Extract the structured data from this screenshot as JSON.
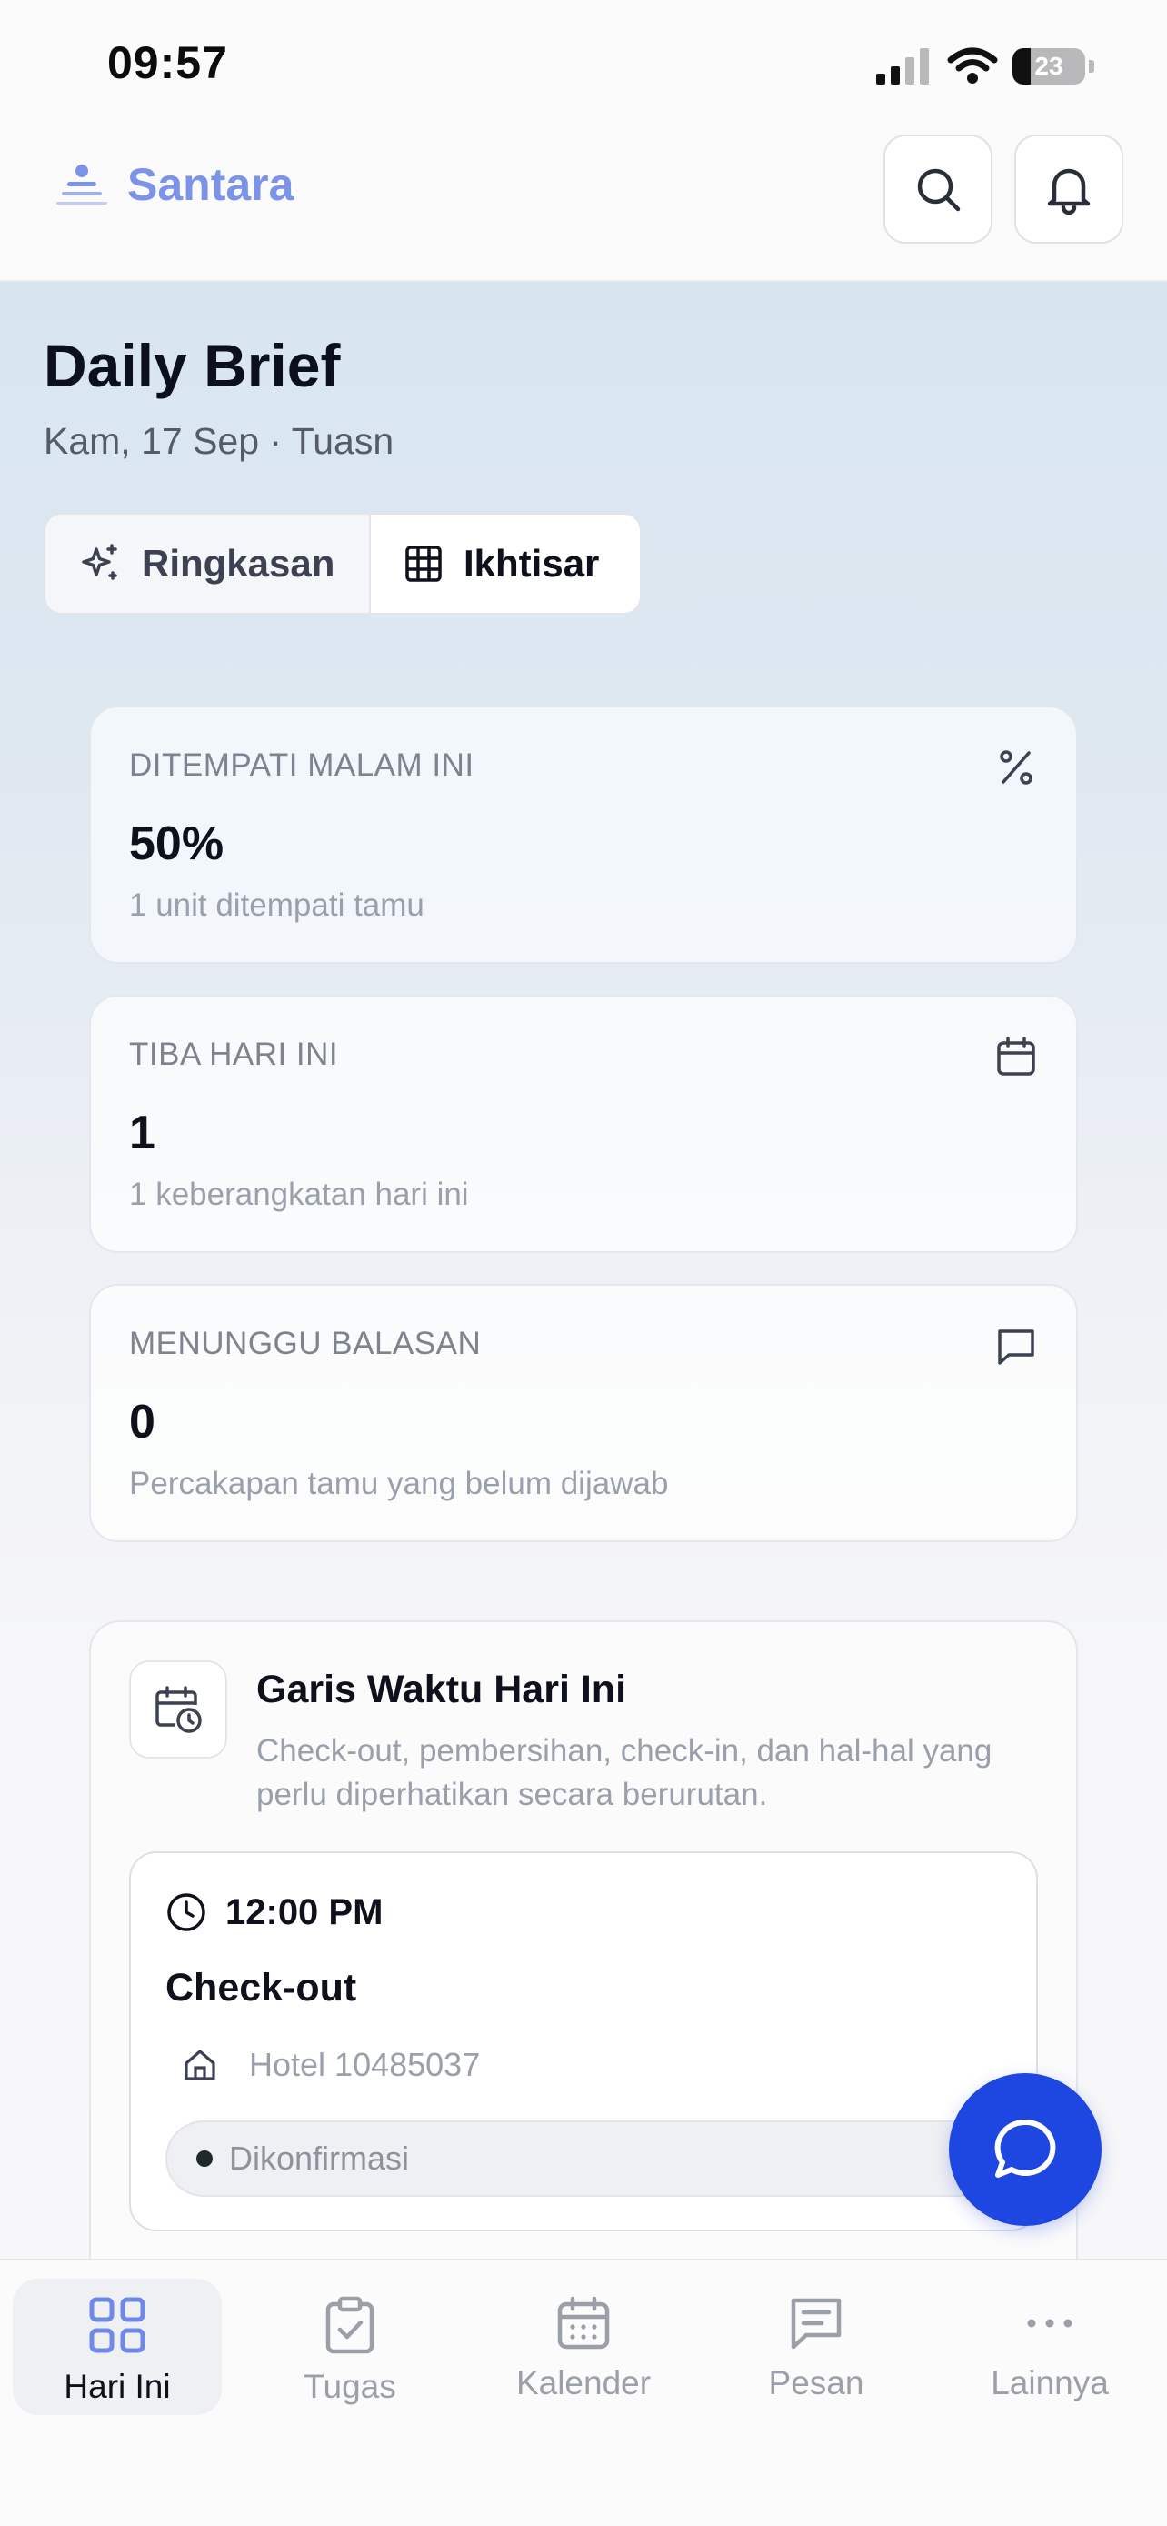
{
  "status_bar": {
    "time": "09:57",
    "battery": "23"
  },
  "header": {
    "brand": "Santara"
  },
  "page": {
    "title": "Daily Brief",
    "subtitle": "Kam, 17 Sep · Tuasn"
  },
  "view_toggle": {
    "items": [
      {
        "label": "Ringkasan"
      },
      {
        "label": "Ikhtisar"
      }
    ],
    "selected": "Ikhtisar"
  },
  "stats": [
    {
      "label": "DITEMPATI MALAM INI",
      "value": "50%",
      "caption": "1 unit ditempati tamu",
      "icon": "percent-icon"
    },
    {
      "label": "TIBA HARI INI",
      "value": "1",
      "caption": "1 keberangkatan hari ini",
      "icon": "calendar-icon"
    },
    {
      "label": "MENUNGGU BALASAN",
      "value": "0",
      "caption": "Percakapan tamu yang belum dijawab",
      "icon": "message-icon"
    }
  ],
  "timeline": {
    "title": "Garis Waktu Hari Ini",
    "description": "Check-out, pembersihan, check-in, dan hal-hal yang perlu diperhatikan secara berurutan.",
    "events": [
      {
        "time": "12:00 PM",
        "type": "Check-out",
        "property": "Hotel 10485037",
        "status": "Dikonfirmasi"
      }
    ]
  },
  "tabbar": {
    "items": [
      {
        "label": "Hari Ini",
        "icon": "grid-icon"
      },
      {
        "label": "Tugas",
        "icon": "clipboard-check-icon"
      },
      {
        "label": "Kalender",
        "icon": "calendar-icon"
      },
      {
        "label": "Pesan",
        "icon": "message-text-icon"
      },
      {
        "label": "Lainnya",
        "icon": "more-icon"
      }
    ],
    "active": "Hari Ini"
  },
  "colors": {
    "brand": "#7b93e8",
    "fab": "#1e46e0",
    "active_tab_icon": "#6f8ae6",
    "inactive": "#9ba0a8"
  }
}
